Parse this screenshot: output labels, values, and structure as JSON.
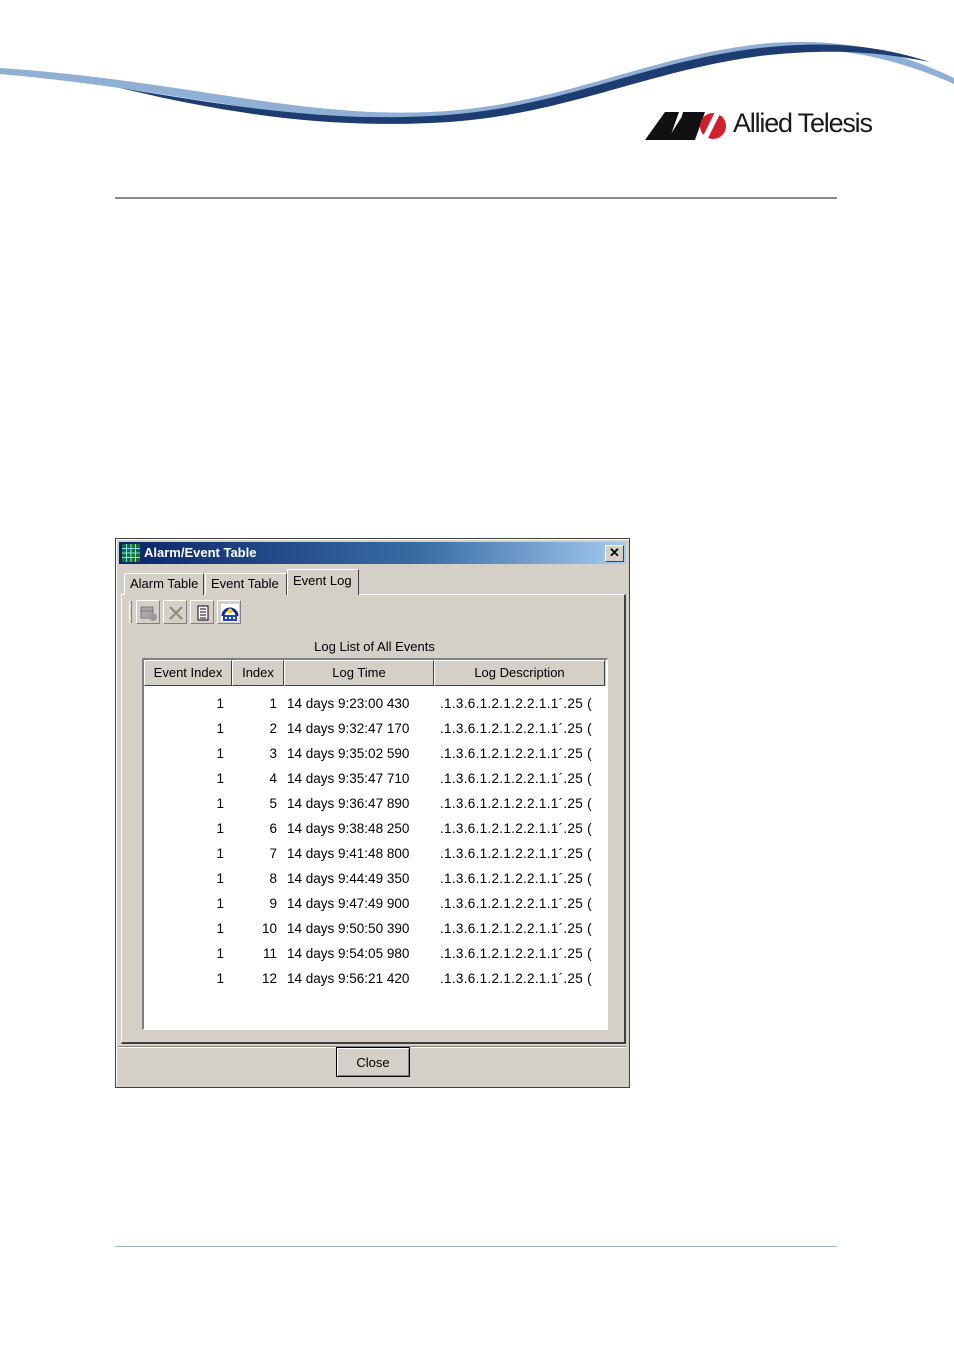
{
  "brand": {
    "name": "Allied Telesis",
    "colors": {
      "swoosh_dark": "#1d3c72",
      "swoosh_light": "#8fb0d4",
      "logo_red": "#d0202e"
    }
  },
  "window": {
    "title": "Alarm/Event Table",
    "title_icon": "grid-app-icon",
    "close_label": "✕"
  },
  "tabs": [
    {
      "label": "Alarm Table",
      "active": false
    },
    {
      "label": "Event Table",
      "active": false
    },
    {
      "label": "Event Log",
      "active": true
    }
  ],
  "toolbar": {
    "buttons": [
      {
        "icon": "add-row-icon",
        "enabled": false
      },
      {
        "icon": "delete-icon",
        "enabled": false
      },
      {
        "icon": "details-list-icon",
        "enabled": true
      },
      {
        "icon": "refresh-network-icon",
        "enabled": true
      }
    ]
  },
  "log_table": {
    "caption": "Log List of All Events",
    "columns": [
      "Event Index",
      "Index",
      "Log Time",
      "Log Description"
    ],
    "rows": [
      {
        "event_index": "1",
        "index": "1",
        "log_time": "14 days 9:23:00 430",
        "log_description": ".1.3.6.1.2.1.2.2.1.1´.25 ("
      },
      {
        "event_index": "1",
        "index": "2",
        "log_time": "14 days 9:32:47 170",
        "log_description": ".1.3.6.1.2.1.2.2.1.1´.25 ("
      },
      {
        "event_index": "1",
        "index": "3",
        "log_time": "14 days 9:35:02 590",
        "log_description": ".1.3.6.1.2.1.2.2.1.1´.25 ("
      },
      {
        "event_index": "1",
        "index": "4",
        "log_time": "14 days 9:35:47 710",
        "log_description": ".1.3.6.1.2.1.2.2.1.1´.25 ("
      },
      {
        "event_index": "1",
        "index": "5",
        "log_time": "14 days 9:36:47 890",
        "log_description": ".1.3.6.1.2.1.2.2.1.1´.25 ("
      },
      {
        "event_index": "1",
        "index": "6",
        "log_time": "14 days 9:38:48 250",
        "log_description": ".1.3.6.1.2.1.2.2.1.1´.25 ("
      },
      {
        "event_index": "1",
        "index": "7",
        "log_time": "14 days 9:41:48 800",
        "log_description": ".1.3.6.1.2.1.2.2.1.1´.25 ("
      },
      {
        "event_index": "1",
        "index": "8",
        "log_time": "14 days 9:44:49 350",
        "log_description": ".1.3.6.1.2.1.2.2.1.1´.25 ("
      },
      {
        "event_index": "1",
        "index": "9",
        "log_time": "14 days 9:47:49 900",
        "log_description": ".1.3.6.1.2.1.2.2.1.1´.25 ("
      },
      {
        "event_index": "1",
        "index": "10",
        "log_time": "14 days 9:50:50 390",
        "log_description": ".1.3.6.1.2.1.2.2.1.1´.25 ("
      },
      {
        "event_index": "1",
        "index": "11",
        "log_time": "14 days 9:54:05 980",
        "log_description": ".1.3.6.1.2.1.2.2.1.1´.25 ("
      },
      {
        "event_index": "1",
        "index": "12",
        "log_time": "14 days 9:56:21 420",
        "log_description": ".1.3.6.1.2.1.2.2.1.1´.25 ("
      }
    ]
  },
  "footer": {
    "close_button_label": "Close"
  }
}
